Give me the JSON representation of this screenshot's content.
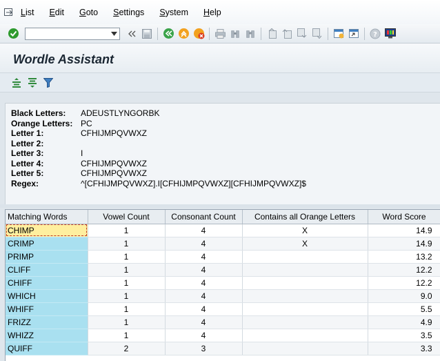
{
  "menu": {
    "items": [
      "List",
      "Edit",
      "Goto",
      "Settings",
      "System",
      "Help"
    ]
  },
  "toolbar": {
    "command_value": "",
    "icons": [
      "enter-icon",
      "history-icon",
      "save-icon",
      "back-icon",
      "exit-icon",
      "cancel-icon",
      "print-icon",
      "find-icon",
      "find-next-icon",
      "first-page-icon",
      "prev-page-icon",
      "next-page-icon",
      "last-page-icon",
      "create-session-icon",
      "shortcut-icon",
      "help-icon",
      "customize-icon"
    ],
    "colors": {
      "enter": "#2e9a2e",
      "back": "#3aa34a",
      "exit": "#f2a11f",
      "cancel": "#d9391e"
    }
  },
  "title": "Wordle Assistant",
  "app_toolbar": {
    "icons": [
      "sort-ascending-icon",
      "sort-descending-icon",
      "filter-icon"
    ]
  },
  "info": {
    "rows": [
      {
        "label": "Black Letters:",
        "value": "ADEUSTLYNGORBK"
      },
      {
        "label": "Orange Letters:",
        "value": "PC"
      },
      {
        "label": "Letter 1:",
        "value": "CFHIJMPQVWXZ"
      },
      {
        "label": "Letter 2:",
        "value": ""
      },
      {
        "label": "Letter 3:",
        "value": "I"
      },
      {
        "label": "Letter 4:",
        "value": "CFHIJMPQVWXZ"
      },
      {
        "label": "Letter 5:",
        "value": "CFHIJMPQVWXZ"
      },
      {
        "label": "Regex:",
        "value": "^[CFHIJMPQVWXZ].I[CFHIJMPQVWXZ][CFHIJMPQVWXZ]$"
      }
    ]
  },
  "table": {
    "columns": [
      "Matching Words",
      "Vowel Count",
      "Consonant Count",
      "Contains all Orange Letters",
      "Word Score"
    ],
    "rows": [
      {
        "word": "CHIMP",
        "vowels": "1",
        "consonants": "4",
        "orange": "X",
        "score": "14.9"
      },
      {
        "word": "CRIMP",
        "vowels": "1",
        "consonants": "4",
        "orange": "X",
        "score": "14.9"
      },
      {
        "word": "PRIMP",
        "vowels": "1",
        "consonants": "4",
        "orange": "",
        "score": "13.2"
      },
      {
        "word": "CLIFF",
        "vowels": "1",
        "consonants": "4",
        "orange": "",
        "score": "12.2"
      },
      {
        "word": "CHIFF",
        "vowels": "1",
        "consonants": "4",
        "orange": "",
        "score": "12.2"
      },
      {
        "word": "WHICH",
        "vowels": "1",
        "consonants": "4",
        "orange": "",
        "score": "9.0"
      },
      {
        "word": "WHIFF",
        "vowels": "1",
        "consonants": "4",
        "orange": "",
        "score": "5.5"
      },
      {
        "word": "FRIZZ",
        "vowels": "1",
        "consonants": "4",
        "orange": "",
        "score": "4.9"
      },
      {
        "word": "WHIZZ",
        "vowels": "1",
        "consonants": "4",
        "orange": "",
        "score": "3.5"
      },
      {
        "word": "QUIFF",
        "vowels": "2",
        "consonants": "3",
        "orange": "",
        "score": "3.3"
      }
    ]
  }
}
